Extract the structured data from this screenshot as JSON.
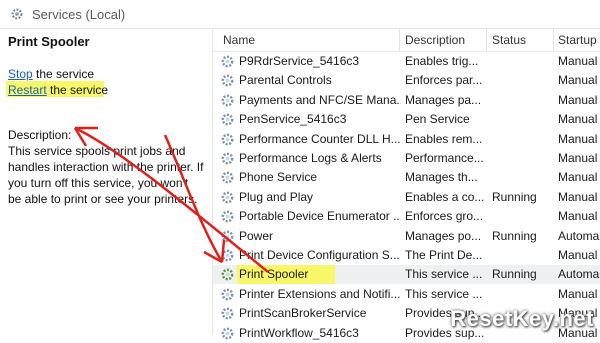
{
  "window": {
    "title": "Services (Local)"
  },
  "left_panel": {
    "service_name": "Print Spooler",
    "stop_link": "Stop",
    "stop_rest": " the service",
    "restart_link": "Restart",
    "restart_rest": " the service",
    "description_label": "Description:",
    "description_text": "This service spools print jobs and handles interaction with the printer. If you turn off this service, you won't be able to print or see your printers."
  },
  "columns": {
    "name": "Name",
    "description": "Description",
    "status": "Status",
    "startup": "Startup"
  },
  "services": [
    {
      "name": "P9RdrService_5416c3",
      "description": "Enables trig...",
      "status": "",
      "startup": "Manual"
    },
    {
      "name": "Parental Controls",
      "description": "Enforces par...",
      "status": "",
      "startup": "Manual"
    },
    {
      "name": "Payments and NFC/SE Mana...",
      "description": "Manages pa...",
      "status": "",
      "startup": "Manual"
    },
    {
      "name": "PenService_5416c3",
      "description": "Pen Service",
      "status": "",
      "startup": "Manual"
    },
    {
      "name": "Performance Counter DLL H...",
      "description": "Enables rem...",
      "status": "",
      "startup": "Manual"
    },
    {
      "name": "Performance Logs & Alerts",
      "description": "Performance...",
      "status": "",
      "startup": "Manual"
    },
    {
      "name": "Phone Service",
      "description": "Manages th...",
      "status": "",
      "startup": "Manual"
    },
    {
      "name": "Plug and Play",
      "description": "Enables a co...",
      "status": "Running",
      "startup": "Manual"
    },
    {
      "name": "Portable Device Enumerator ...",
      "description": "Enforces gro...",
      "status": "",
      "startup": "Manual"
    },
    {
      "name": "Power",
      "description": "Manages po...",
      "status": "Running",
      "startup": "Automa"
    },
    {
      "name": "Print Device Configuration S...",
      "description": "The Print De...",
      "status": "",
      "startup": "Manual"
    },
    {
      "name": "Print Spooler",
      "description": "This service ...",
      "status": "Running",
      "startup": "Automa"
    },
    {
      "name": "Printer Extensions and Notifi...",
      "description": "This service ...",
      "status": "",
      "startup": "Manual"
    },
    {
      "name": "PrintScanBrokerService",
      "description": "Provides sup...",
      "status": "",
      "startup": "Manual"
    },
    {
      "name": "PrintWorkflow_5416c3",
      "description": "Provides sup...",
      "status": "",
      "startup": "Manual"
    }
  ],
  "watermark": "ResetKey.net",
  "colors": {
    "highlight": "#f8f76a",
    "arrow": "#e0201a",
    "link": "#1c5fb4"
  }
}
